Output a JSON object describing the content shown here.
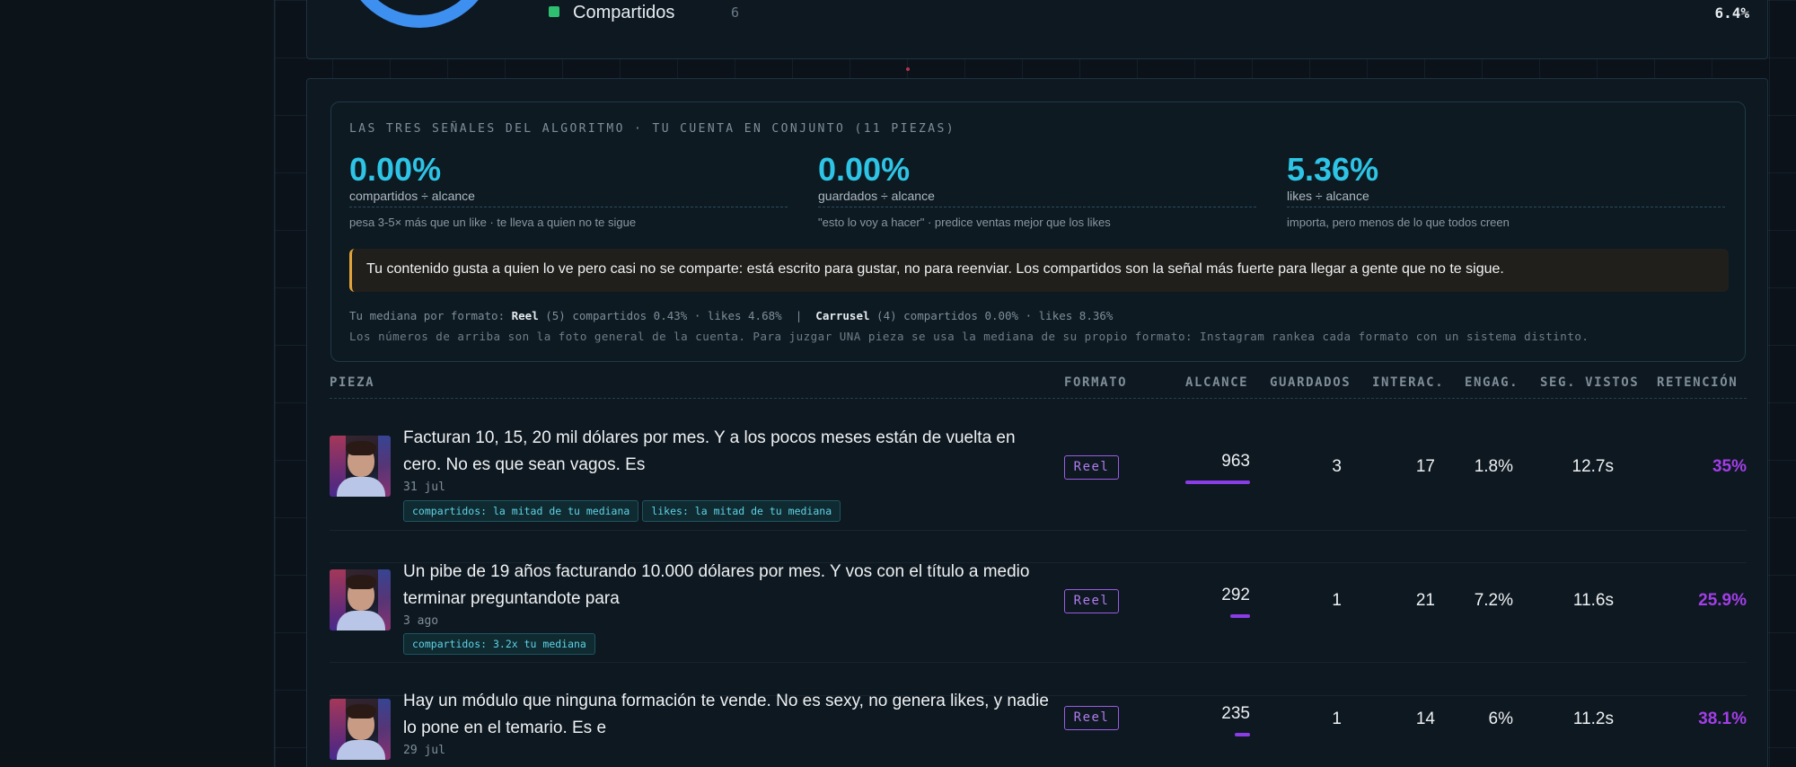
{
  "top_card": {
    "legend_label": "Compartidos",
    "legend_count": "6",
    "legend_pct": "6.4%",
    "legend_color": "#2fbf71",
    "donut_color": "#3d8ff0"
  },
  "signals": {
    "title": "LAS TRES SEÑALES DEL ALGORITMO · TU CUENTA EN CONJUNTO (11 PIEZAS)",
    "metrics": [
      {
        "value": "0.00%",
        "label": "compartidos ÷ alcance",
        "note": "pesa 3-5× más que un like · te lleva a quien no te sigue"
      },
      {
        "value": "0.00%",
        "label": "guardados ÷ alcance",
        "note": "\"esto lo voy a hacer\" · predice ventas mejor que los likes"
      },
      {
        "value": "5.36%",
        "label": "likes ÷ alcance",
        "note": "importa, pero menos de lo que todos creen"
      }
    ],
    "insight": "Tu contenido gusta a quien lo ve pero casi no se comparte: está escrito para gustar, no para reenviar. Los compartidos son la señal más fuerte para llegar a gente que no te sigue.",
    "median_prefix": "Tu mediana por formato: ",
    "median_reel_label": "Reel",
    "median_reel_text": " (5) compartidos 0.43% · likes 4.68%  |  ",
    "median_carrusel_label": "Carrusel",
    "median_carrusel_text": " (4) compartidos 0.00% · likes 8.36%",
    "median_note": "Los números de arriba son la foto general de la cuenta. Para juzgar UNA pieza se usa la mediana de su propio formato: Instagram rankea cada formato con un sistema distinto."
  },
  "table": {
    "headers": {
      "pieza": "PIEZA",
      "formato": "FORMATO",
      "alcance": "ALCANCE",
      "guardados": "GUARDADOS",
      "interac": "INTERAC.",
      "engag": "ENGAG.",
      "seg_vistos": "SEG. VISTOS",
      "retencion": "RETENCIÓN"
    },
    "rows": [
      {
        "title": "Facturan 10, 15, 20 mil dólares por mes. Y a los pocos meses están de vuelta en cero. No es que sean vagos. Es",
        "date": "31 jul",
        "tags": [
          "compartidos: la mitad de tu mediana",
          "likes: la mitad de tu mediana"
        ],
        "format": "Reel",
        "reach": "963",
        "reach_fraction": 1.0,
        "saves": "3",
        "interactions": "17",
        "engagement": "1.8%",
        "seconds": "12.7s",
        "retention": "35%"
      },
      {
        "title": "Un pibe de 19 años facturando 10.000 dólares por mes. Y vos con el título a medio terminar preguntandote para",
        "date": "3 ago",
        "tags": [
          "compartidos: 3.2x tu mediana"
        ],
        "format": "Reel",
        "reach": "292",
        "reach_fraction": 0.3,
        "saves": "1",
        "interactions": "21",
        "engagement": "7.2%",
        "seconds": "11.6s",
        "retention": "25.9%"
      },
      {
        "title": "Hay un módulo que ninguna formación te vende. No es sexy, no genera likes, y nadie lo pone en el temario. Es e",
        "date": "29 jul",
        "tags": [],
        "format": "Reel",
        "reach": "235",
        "reach_fraction": 0.24,
        "saves": "1",
        "interactions": "14",
        "engagement": "6%",
        "seconds": "11.2s",
        "retention": "38.1%"
      }
    ]
  }
}
